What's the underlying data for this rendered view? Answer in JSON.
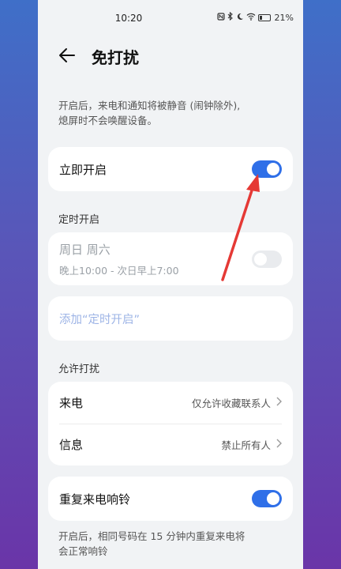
{
  "status_bar": {
    "time": "10:20",
    "battery_percent": "21%",
    "icons": [
      "nfc-icon",
      "bluetooth-icon",
      "moon-icon",
      "wifi-icon",
      "battery-icon"
    ]
  },
  "header": {
    "title": "免打扰"
  },
  "intro": {
    "line1": "开启后，来电和通知将被静音 (闹钟除外),",
    "line2": "熄屏时不会唤醒设备。"
  },
  "immediate": {
    "label": "立即开启",
    "toggle_on": true
  },
  "schedule": {
    "section_title": "定时开启",
    "days": "周日 周六",
    "time_range": "晚上10:00 - 次日早上7:00",
    "toggle_on": false,
    "add_label": "添加“定时开启”"
  },
  "allow": {
    "section_title": "允许打扰",
    "calls_label": "来电",
    "calls_value": "仅允许收藏联系人",
    "messages_label": "信息",
    "messages_value": "禁止所有人"
  },
  "repeat": {
    "label": "重复来电响铃",
    "toggle_on": true,
    "desc_line1": "开启后，相同号码在 15 分钟内重复来电将",
    "desc_line2": "会正常响铃"
  },
  "colors": {
    "accent": "#2f6fe8",
    "annotation_arrow": "#e53935"
  }
}
